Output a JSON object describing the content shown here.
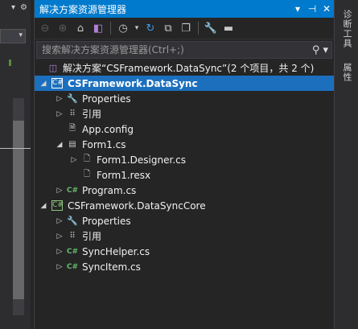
{
  "left_strip": {
    "icons": [
      "chevron-down-icon",
      "gear-icon",
      "pin-icon"
    ],
    "dropdown_arrow": "▾"
  },
  "panel": {
    "title": "解决方案资源管理器",
    "title_buttons": [
      "▾",
      "⊣",
      "✕"
    ]
  },
  "toolbar": {
    "items": [
      "back-icon",
      "forward-icon",
      "home-icon",
      "vs-icon",
      "history-icon",
      "refresh-icon",
      "collapse-all-icon",
      "show-all-files-icon",
      "properties-wrench-icon",
      "preview-icon"
    ]
  },
  "search": {
    "placeholder": "搜索解决方案资源管理器(Ctrl+;)"
  },
  "tree": {
    "solution": "解决方案“CSFramework.DataSync”(2 个项目，共 2 个)",
    "project1": {
      "name": "CSFramework.DataSync",
      "properties": "Properties",
      "references": "引用",
      "app_config": "App.config",
      "form1": "Form1.cs",
      "form1_designer": "Form1.Designer.cs",
      "form1_resx": "Form1.resx",
      "program": "Program.cs"
    },
    "project2": {
      "name": "CSFramework.DataSyncCore",
      "properties": "Properties",
      "references": "引用",
      "sync_helper": "SyncHelper.cs",
      "sync_item": "SyncItem.cs"
    }
  },
  "right_tabs": {
    "diagnostics": "诊断工具",
    "properties": "属性"
  },
  "colors": {
    "accent": "#007acc",
    "selection": "#1c6fbd",
    "background": "#252526"
  }
}
